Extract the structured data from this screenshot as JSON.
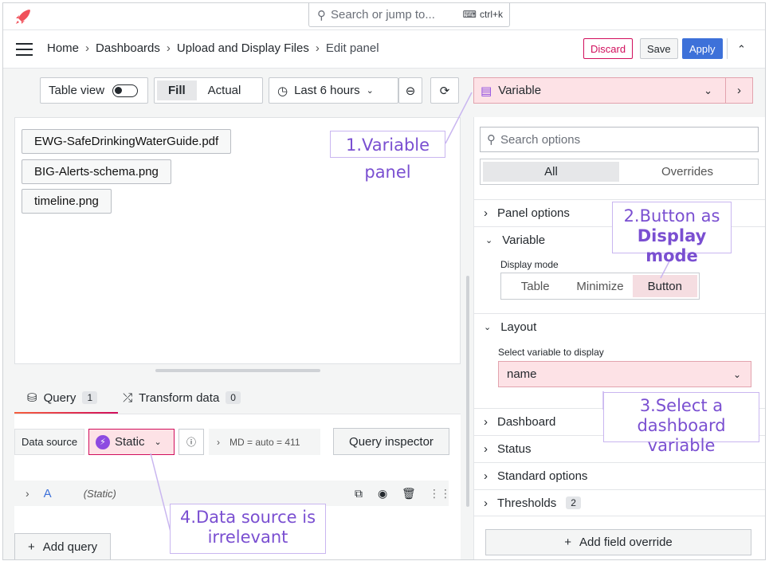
{
  "topbar": {
    "search_placeholder": "Search or jump to...",
    "shortcut": "ctrl+k"
  },
  "breadcrumb": {
    "items": [
      "Home",
      "Dashboards",
      "Upload and Display Files",
      "Edit panel"
    ],
    "separator": "›"
  },
  "actions": {
    "discard": "Discard",
    "save": "Save",
    "apply": "Apply"
  },
  "toolbar": {
    "table_view": "Table view",
    "fill": "Fill",
    "actual": "Actual",
    "time_range": "Last 6 hours"
  },
  "preview": {
    "files": [
      "EWG-SafeDrinkingWaterGuide.pdf",
      "BIG-Alerts-schema.png",
      "timeline.png"
    ]
  },
  "query_tabs": {
    "query": "Query",
    "query_count": "1",
    "transform": "Transform data",
    "transform_count": "0"
  },
  "query_panel": {
    "data_source_label": "Data source",
    "data_source_value": "Static",
    "md_info": "MD = auto = 411",
    "query_inspector": "Query inspector",
    "query_ref": "A",
    "query_type": "(Static)",
    "add_query": "Add query"
  },
  "visualization": {
    "name": "Variable"
  },
  "options": {
    "search_placeholder": "Search options",
    "tab_all": "All",
    "tab_overrides": "Overrides",
    "sections": {
      "panel_options": "Panel options",
      "variable": "Variable",
      "layout": "Layout",
      "dashboard": "Dashboard",
      "status": "Status",
      "standard_options": "Standard options",
      "thresholds": "Thresholds"
    },
    "thresholds_count": "2",
    "display_mode_label": "Display mode",
    "display_modes": [
      "Table",
      "Minimize",
      "Button"
    ],
    "select_variable_label": "Select variable to display",
    "selected_variable": "name",
    "add_field_override": "Add field override"
  },
  "annotations": {
    "a1": "1.Variable panel",
    "a2_line1": "2.Button as",
    "a2_line2": "Display mode",
    "a3_line1": "3.Select a dashboard",
    "a3_line2": "variable",
    "a4_line1": "4.Data source is",
    "a4_line2": "irrelevant"
  },
  "colors": {
    "accent_blue": "#3d71d9",
    "discard_red": "#d10e5c",
    "highlight_pink": "#fde2e6",
    "annotation_purple": "#7a4fd1"
  }
}
